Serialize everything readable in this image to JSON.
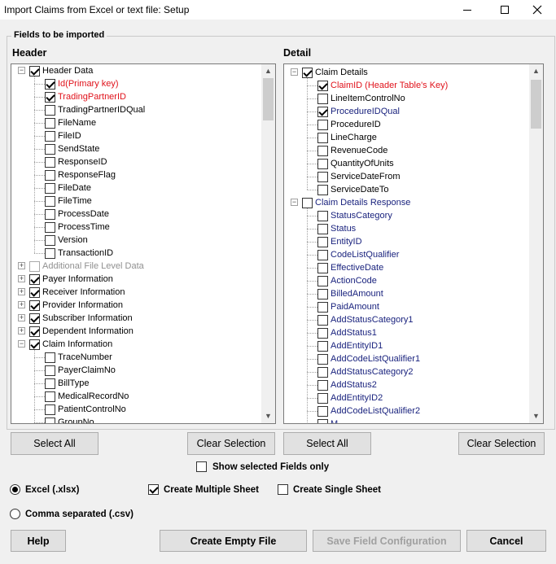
{
  "window": {
    "title": "Import Claims from Excel or text file: Setup"
  },
  "fields_group": {
    "legend": "Fields to be imported",
    "header_title": "Header",
    "detail_title": "Detail"
  },
  "header_tree": {
    "nodes": [
      {
        "text": "Header Data",
        "level": 0,
        "checked": true,
        "expander": "minus",
        "style": "normal"
      },
      {
        "text": "Id(Primary key)",
        "level": 1,
        "checked": true,
        "style": "red"
      },
      {
        "text": "TradingPartnerID",
        "level": 1,
        "checked": true,
        "style": "red"
      },
      {
        "text": "TradingPartnerIDQual",
        "level": 1,
        "checked": false,
        "style": "normal"
      },
      {
        "text": "FileName",
        "level": 1,
        "checked": false,
        "style": "normal"
      },
      {
        "text": "FileID",
        "level": 1,
        "checked": false,
        "style": "normal"
      },
      {
        "text": "SendState",
        "level": 1,
        "checked": false,
        "style": "normal"
      },
      {
        "text": "ResponseID",
        "level": 1,
        "checked": false,
        "style": "normal"
      },
      {
        "text": "ResponseFlag",
        "level": 1,
        "checked": false,
        "style": "normal"
      },
      {
        "text": "FileDate",
        "level": 1,
        "checked": false,
        "style": "normal"
      },
      {
        "text": "FileTime",
        "level": 1,
        "checked": false,
        "style": "normal"
      },
      {
        "text": "ProcessDate",
        "level": 1,
        "checked": false,
        "style": "normal"
      },
      {
        "text": "ProcessTime",
        "level": 1,
        "checked": false,
        "style": "normal"
      },
      {
        "text": "Version",
        "level": 1,
        "checked": false,
        "style": "normal"
      },
      {
        "text": "TransactionID",
        "level": 1,
        "checked": false,
        "style": "normal"
      },
      {
        "text": "Additional File Level Data",
        "level": 0,
        "checked": false,
        "expander": "plus",
        "style": "grey"
      },
      {
        "text": "Payer Information",
        "level": 0,
        "checked": true,
        "expander": "plus",
        "style": "normal"
      },
      {
        "text": "Receiver Information",
        "level": 0,
        "checked": true,
        "expander": "plus",
        "style": "normal"
      },
      {
        "text": "Provider Information",
        "level": 0,
        "checked": true,
        "expander": "plus",
        "style": "normal"
      },
      {
        "text": "Subscriber Information",
        "level": 0,
        "checked": true,
        "expander": "plus",
        "style": "normal"
      },
      {
        "text": "Dependent Information",
        "level": 0,
        "checked": true,
        "expander": "plus",
        "style": "normal"
      },
      {
        "text": "Claim Information",
        "level": 0,
        "checked": true,
        "expander": "minus",
        "style": "normal"
      },
      {
        "text": "TraceNumber",
        "level": 1,
        "checked": false,
        "style": "normal"
      },
      {
        "text": "PayerClaimNo",
        "level": 1,
        "checked": false,
        "style": "normal"
      },
      {
        "text": "BillType",
        "level": 1,
        "checked": false,
        "style": "normal"
      },
      {
        "text": "MedicalRecordNo",
        "level": 1,
        "checked": false,
        "style": "normal"
      },
      {
        "text": "PatientControlNo",
        "level": 1,
        "checked": false,
        "style": "normal"
      },
      {
        "text": "GroupNo",
        "level": 1,
        "checked": false,
        "style": "normal"
      }
    ]
  },
  "detail_tree": {
    "nodes": [
      {
        "text": "Claim Details",
        "level": 0,
        "checked": true,
        "expander": "minus",
        "style": "normal"
      },
      {
        "text": "ClaimID (Header Table's Key)",
        "level": 1,
        "checked": true,
        "style": "red"
      },
      {
        "text": "LineItemControlNo",
        "level": 1,
        "checked": false,
        "style": "normal"
      },
      {
        "text": "ProcedureIDQual",
        "level": 1,
        "checked": true,
        "style": "navy"
      },
      {
        "text": "ProcedureID",
        "level": 1,
        "checked": false,
        "style": "normal"
      },
      {
        "text": "LineCharge",
        "level": 1,
        "checked": false,
        "style": "normal"
      },
      {
        "text": "RevenueCode",
        "level": 1,
        "checked": false,
        "style": "normal"
      },
      {
        "text": "QuantityOfUnits",
        "level": 1,
        "checked": false,
        "style": "normal"
      },
      {
        "text": "ServiceDateFrom",
        "level": 1,
        "checked": false,
        "style": "normal"
      },
      {
        "text": "ServiceDateTo",
        "level": 1,
        "checked": false,
        "style": "normal"
      },
      {
        "text": "Claim Details Response",
        "level": 0,
        "checked": false,
        "expander": "minus",
        "style": "navy"
      },
      {
        "text": "StatusCategory",
        "level": 1,
        "checked": false,
        "style": "navy"
      },
      {
        "text": "Status",
        "level": 1,
        "checked": false,
        "style": "navy"
      },
      {
        "text": "EntityID",
        "level": 1,
        "checked": false,
        "style": "navy"
      },
      {
        "text": "CodeListQualifier",
        "level": 1,
        "checked": false,
        "style": "navy"
      },
      {
        "text": "EffectiveDate",
        "level": 1,
        "checked": false,
        "style": "navy"
      },
      {
        "text": "ActionCode",
        "level": 1,
        "checked": false,
        "style": "navy"
      },
      {
        "text": "BilledAmount",
        "level": 1,
        "checked": false,
        "style": "navy"
      },
      {
        "text": "PaidAmount",
        "level": 1,
        "checked": false,
        "style": "navy"
      },
      {
        "text": "AddStatusCategory1",
        "level": 1,
        "checked": false,
        "style": "navy"
      },
      {
        "text": "AddStatus1",
        "level": 1,
        "checked": false,
        "style": "navy"
      },
      {
        "text": "AddEntityID1",
        "level": 1,
        "checked": false,
        "style": "navy"
      },
      {
        "text": "AddCodeListQualifier1",
        "level": 1,
        "checked": false,
        "style": "navy"
      },
      {
        "text": "AddStatusCategory2",
        "level": 1,
        "checked": false,
        "style": "navy"
      },
      {
        "text": "AddStatus2",
        "level": 1,
        "checked": false,
        "style": "navy"
      },
      {
        "text": "AddEntityID2",
        "level": 1,
        "checked": false,
        "style": "navy"
      },
      {
        "text": "AddCodeListQualifier2",
        "level": 1,
        "checked": false,
        "style": "navy"
      },
      {
        "text": "M...",
        "level": 1,
        "checked": false,
        "style": "navy"
      }
    ]
  },
  "buttons": {
    "header_select_all": "Select All",
    "header_clear_selection": "Clear Selection",
    "detail_select_all": "Select All",
    "detail_clear_selection": "Clear Selection",
    "help": "Help",
    "create_empty_file": "Create Empty File",
    "save_field_configuration": "Save Field Configuration",
    "cancel": "Cancel"
  },
  "options": {
    "show_selected_only": {
      "label": "Show selected Fields only",
      "checked": false
    },
    "excel": {
      "label": "Excel (.xlsx)",
      "selected": true
    },
    "csv": {
      "label": "Comma separated (.csv)",
      "selected": false
    },
    "create_multiple_sheet": {
      "label": "Create Multiple Sheet",
      "checked": true
    },
    "create_single_sheet": {
      "label": "Create Single Sheet",
      "checked": false
    }
  },
  "colors": {
    "required_field": "#e0121b",
    "detail_field": "#1a237e",
    "disabled_text": "#909090"
  }
}
